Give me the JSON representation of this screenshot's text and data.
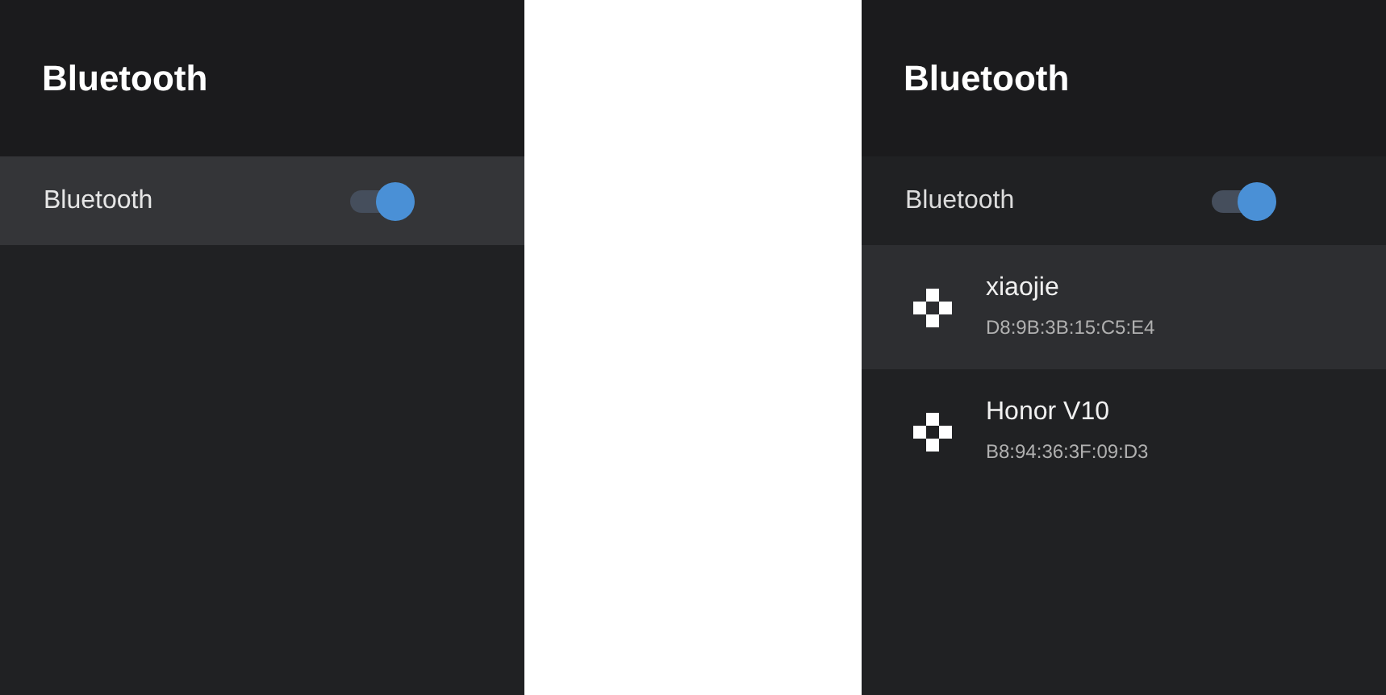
{
  "panels": [
    {
      "title": "Bluetooth",
      "toggle": {
        "label": "Bluetooth",
        "on": true,
        "selected": true
      }
    },
    {
      "title": "Bluetooth",
      "toggle": {
        "label": "Bluetooth",
        "on": true,
        "selected": false
      },
      "devices": [
        {
          "name": "xiaojie",
          "address": "D8:9B:3B:15:C5:E4",
          "selected": true
        },
        {
          "name": "Honor V10",
          "address": "B8:94:36:3F:09:D3",
          "selected": false
        }
      ]
    }
  ]
}
